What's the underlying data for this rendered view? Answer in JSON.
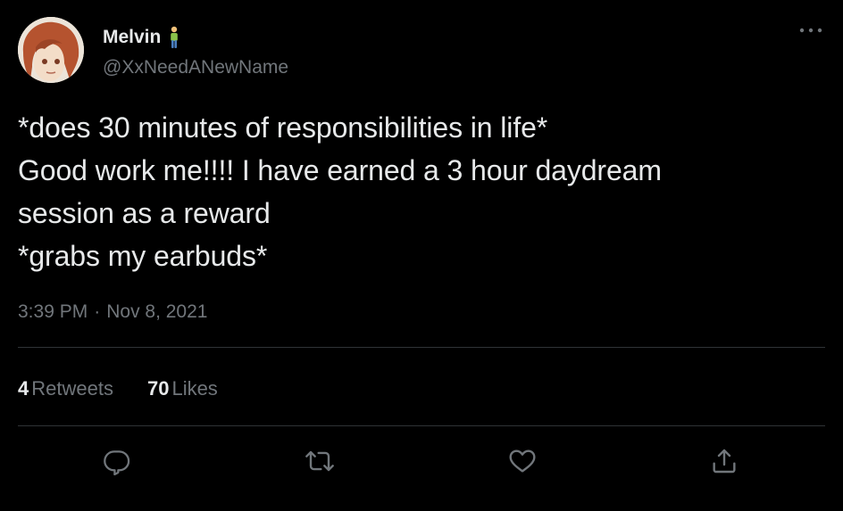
{
  "author": {
    "display_name": "Melvin",
    "handle": "@XxNeedANewName",
    "name_emoji": "person-standing-emoji",
    "avatar": "anime-avatar-image"
  },
  "tweet": {
    "lines": [
      "*does 30 minutes of responsibilities in life*",
      "Good work me!!!! I have earned a 3 hour daydream",
      "session as a reward",
      "*grabs my earbuds*"
    ],
    "time": "3:39 PM",
    "separator": "·",
    "date": "Nov 8, 2021"
  },
  "stats": {
    "retweets": {
      "count": "4",
      "label": "Retweets"
    },
    "likes": {
      "count": "70",
      "label": "Likes"
    }
  },
  "actions": {
    "reply": "reply-icon",
    "retweet": "retweet-icon",
    "like": "heart-icon",
    "share": "share-icon",
    "more": "more-dots-icon"
  },
  "colors": {
    "background": "#000000",
    "primary_text": "#e7e9ea",
    "secondary_text": "#71767b",
    "divider": "#2f3336"
  }
}
